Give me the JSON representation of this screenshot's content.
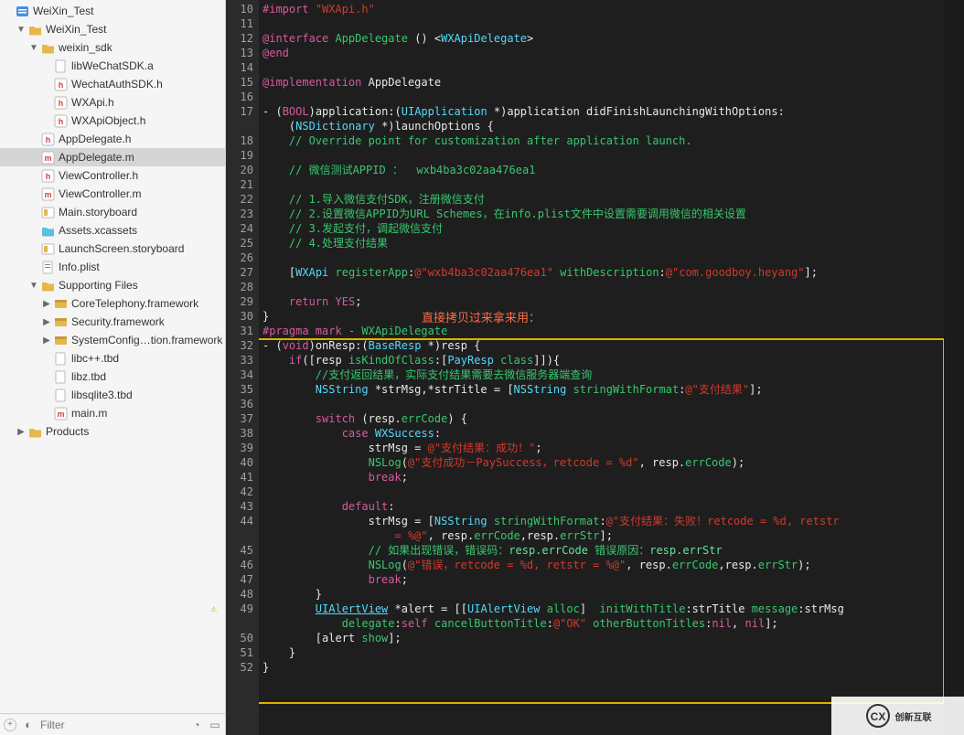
{
  "sidebar": {
    "filter_placeholder": "Filter",
    "tree": [
      {
        "depth": 0,
        "disclosure": "",
        "icon": "proj",
        "label": "WeiXin_Test",
        "selected": false
      },
      {
        "depth": 1,
        "disclosure": "▼",
        "icon": "folder",
        "label": "WeiXin_Test",
        "selected": false
      },
      {
        "depth": 2,
        "disclosure": "▼",
        "icon": "folder",
        "label": "weixin_sdk",
        "selected": false
      },
      {
        "depth": 3,
        "disclosure": "",
        "icon": "file",
        "label": "libWeChatSDK.a",
        "selected": false
      },
      {
        "depth": 3,
        "disclosure": "",
        "icon": "h",
        "label": "WechatAuthSDK.h",
        "selected": false
      },
      {
        "depth": 3,
        "disclosure": "",
        "icon": "h",
        "label": "WXApi.h",
        "selected": false
      },
      {
        "depth": 3,
        "disclosure": "",
        "icon": "h",
        "label": "WXApiObject.h",
        "selected": false
      },
      {
        "depth": 2,
        "disclosure": "",
        "icon": "h",
        "label": "AppDelegate.h",
        "selected": false
      },
      {
        "depth": 2,
        "disclosure": "",
        "icon": "m",
        "label": "AppDelegate.m",
        "selected": true
      },
      {
        "depth": 2,
        "disclosure": "",
        "icon": "h",
        "label": "ViewController.h",
        "selected": false
      },
      {
        "depth": 2,
        "disclosure": "",
        "icon": "m",
        "label": "ViewController.m",
        "selected": false
      },
      {
        "depth": 2,
        "disclosure": "",
        "icon": "storyboard",
        "label": "Main.storyboard",
        "selected": false
      },
      {
        "depth": 2,
        "disclosure": "",
        "icon": "assets",
        "label": "Assets.xcassets",
        "selected": false
      },
      {
        "depth": 2,
        "disclosure": "",
        "icon": "storyboard",
        "label": "LaunchScreen.storyboard",
        "selected": false
      },
      {
        "depth": 2,
        "disclosure": "",
        "icon": "plist",
        "label": "Info.plist",
        "selected": false
      },
      {
        "depth": 2,
        "disclosure": "▼",
        "icon": "folder",
        "label": "Supporting Files",
        "selected": false
      },
      {
        "depth": 3,
        "disclosure": "▶",
        "icon": "framework",
        "label": "CoreTelephony.framework",
        "selected": false
      },
      {
        "depth": 3,
        "disclosure": "▶",
        "icon": "framework",
        "label": "Security.framework",
        "selected": false
      },
      {
        "depth": 3,
        "disclosure": "▶",
        "icon": "framework",
        "label": "SystemConfig…tion.framework",
        "selected": false
      },
      {
        "depth": 3,
        "disclosure": "",
        "icon": "file",
        "label": "libc++.tbd",
        "selected": false
      },
      {
        "depth": 3,
        "disclosure": "",
        "icon": "file",
        "label": "libz.tbd",
        "selected": false
      },
      {
        "depth": 3,
        "disclosure": "",
        "icon": "file",
        "label": "libsqlite3.tbd",
        "selected": false
      },
      {
        "depth": 3,
        "disclosure": "",
        "icon": "m",
        "label": "main.m",
        "selected": false
      },
      {
        "depth": 1,
        "disclosure": "▶",
        "icon": "folder",
        "label": "Products",
        "selected": false
      }
    ]
  },
  "gutter": {
    "start": 10,
    "end": 52,
    "warn_lines": [
      49
    ]
  },
  "annotation": "直接拷贝过来拿来用：",
  "watermark": "创新互联",
  "code_lines": [
    {
      "n": 10,
      "html": "<span class='kw'>#import</span> <span class='str'>\"WXApi.h\"</span>"
    },
    {
      "n": 11,
      "html": ""
    },
    {
      "n": 12,
      "html": "<span class='kw'>@interface</span> <span class='clsg'>AppDelegate</span> <span class='white'>() &lt;</span><span class='cls'>WXApiDelegate</span><span class='white'>&gt;</span>"
    },
    {
      "n": 13,
      "html": "<span class='kw'>@end</span>"
    },
    {
      "n": 14,
      "html": ""
    },
    {
      "n": 15,
      "html": "<span class='kw'>@implementation</span> <span class='white'>AppDelegate</span>"
    },
    {
      "n": 16,
      "html": ""
    },
    {
      "n": 17,
      "html": "<span class='white'>- (</span><span class='kw'>BOOL</span><span class='white'>)application:(</span><span class='cls'>UIApplication</span> <span class='white'>*)application didFinishLaunchingWithOptions:</span>"
    },
    {
      "n": "",
      "html": "    <span class='white'>(</span><span class='cls'>NSDictionary</span> <span class='white'>*)launchOptions {</span>"
    },
    {
      "n": 18,
      "html": "    <span class='cmt'>// Override point for customization after application launch.</span>"
    },
    {
      "n": 19,
      "html": ""
    },
    {
      "n": 20,
      "html": "    <span class='cmt'>// 微信测试APPID ：  wxb4ba3c02aa476ea1</span>"
    },
    {
      "n": 21,
      "html": ""
    },
    {
      "n": 22,
      "html": "    <span class='cmt'>// 1.导入微信支付SDK，注册微信支付</span>"
    },
    {
      "n": 23,
      "html": "    <span class='cmt'>// 2.设置微信APPID为URL Schemes，在info.plist文件中设置需要调用微信的相关设置</span>"
    },
    {
      "n": 24,
      "html": "    <span class='cmt'>// 3.发起支付，调起微信支付</span>"
    },
    {
      "n": 25,
      "html": "    <span class='cmt'>// 4.处理支付结果</span>"
    },
    {
      "n": 26,
      "html": ""
    },
    {
      "n": 27,
      "html": "    <span class='white'>[</span><span class='cls'>WXApi</span> <span class='mth'>registerApp</span><span class='white'>:</span><span class='str'>@\"wxb4ba3c02aa476ea1\"</span> <span class='mth'>withDescription</span><span class='white'>:</span><span class='str'>@\"com.goodboy.heyang\"</span><span class='white'>];</span>"
    },
    {
      "n": 28,
      "html": ""
    },
    {
      "n": 29,
      "html": "    <span class='kw'>return</span> <span class='kw'>YES</span><span class='white'>;</span>"
    },
    {
      "n": 30,
      "html": "<span class='white'>}</span>"
    },
    {
      "n": 31,
      "html": "<span class='pmark'>#pragma mark</span> <span class='pmarkt'>- WXApiDelegate</span>"
    },
    {
      "n": 32,
      "html": "<span class='white'>- (</span><span class='kw'>void</span><span class='white'>)onResp:(</span><span class='cls'>BaseResp</span> <span class='white'>*)resp {</span>"
    },
    {
      "n": 33,
      "html": "    <span class='kw'>if</span><span class='white'>([resp </span><span class='mth'>isKindOfClass</span><span class='white'>:[</span><span class='cls'>PayResp</span> <span class='mth'>class</span><span class='white'>]]){</span>"
    },
    {
      "n": 34,
      "html": "        <span class='cmt'>//支付返回结果，实际支付结果需要去微信服务器端查询</span>"
    },
    {
      "n": 35,
      "html": "        <span class='cls'>NSString</span> <span class='white'>*strMsg,*strTitle = [</span><span class='cls'>NSString</span> <span class='mth'>stringWithFormat</span><span class='white'>:</span><span class='str'>@\"支付结果\"</span><span class='white'>];</span>"
    },
    {
      "n": 36,
      "html": ""
    },
    {
      "n": 37,
      "html": "        <span class='kw'>switch</span> <span class='white'>(resp.</span><span class='mth'>errCode</span><span class='white'>) {</span>"
    },
    {
      "n": 38,
      "html": "            <span class='kw'>case</span> <span class='cls'>WXSuccess</span><span class='white'>:</span>"
    },
    {
      "n": 39,
      "html": "                <span class='white'>strMsg = </span><span class='str'>@\"支付结果：成功！\"</span><span class='white'>;</span>"
    },
    {
      "n": 40,
      "html": "                <span class='mth'>NSLog</span><span class='white'>(</span><span class='str'>@\"支付成功－PaySuccess，retcode = %d\"</span><span class='white'>, resp.</span><span class='mth'>errCode</span><span class='white'>);</span>"
    },
    {
      "n": 41,
      "html": "                <span class='kw'>break</span><span class='white'>;</span>"
    },
    {
      "n": 42,
      "html": ""
    },
    {
      "n": 43,
      "html": "            <span class='kw'>default</span><span class='white'>:</span>"
    },
    {
      "n": 44,
      "html": "                <span class='white'>strMsg = [</span><span class='cls'>NSString</span> <span class='mth'>stringWithFormat</span><span class='white'>:</span><span class='str'>@\"支付结果：失败！retcode = %d, retstr</span>"
    },
    {
      "n": "",
      "html": "                    <span class='str'>= %@\"</span><span class='white'>, resp.</span><span class='mth'>errCode</span><span class='white'>,resp.</span><span class='mth'>errStr</span><span class='white'>];</span>"
    },
    {
      "n": 45,
      "html": "                <span class='cmt'>// 如果出现错误，错误码：<span class='mth2'>resp.errCode</span> 错误原因：<span class='mth2'>resp.errStr</span></span>"
    },
    {
      "n": 46,
      "html": "                <span class='mth'>NSLog</span><span class='white'>(</span><span class='str'>@\"错误，retcode = %d, retstr = %@\"</span><span class='white'>, resp.</span><span class='mth'>errCode</span><span class='white'>,resp.</span><span class='mth'>errStr</span><span class='white'>);</span>"
    },
    {
      "n": 47,
      "html": "                <span class='kw'>break</span><span class='white'>;</span>"
    },
    {
      "n": 48,
      "html": "        <span class='white'>}</span>"
    },
    {
      "n": 49,
      "html": "        <span class='cls sel'>UIAlertView</span> <span class='white'>*alert = [[</span><span class='cls'>UIAlertView</span> <span class='mth'>alloc</span><span class='white'>]  </span><span class='mth'>initWithTitle</span><span class='white'>:strTitle </span><span class='mth'>message</span><span class='white'>:strMsg</span>"
    },
    {
      "n": "",
      "html": "            <span class='mth'>delegate</span><span class='white'>:</span><span class='kw'>self</span> <span class='mth'>cancelButtonTitle</span><span class='white'>:</span><span class='str'>@\"OK\"</span> <span class='mth'>otherButtonTitles</span><span class='white'>:</span><span class='kw'>nil</span><span class='white'>, </span><span class='kw'>nil</span><span class='white'>];</span>"
    },
    {
      "n": 50,
      "html": "        <span class='white'>[alert </span><span class='mth'>show</span><span class='white'>];</span>"
    },
    {
      "n": 51,
      "html": "    <span class='white'>}</span>"
    },
    {
      "n": 52,
      "html": "<span class='white'>}</span>"
    }
  ]
}
